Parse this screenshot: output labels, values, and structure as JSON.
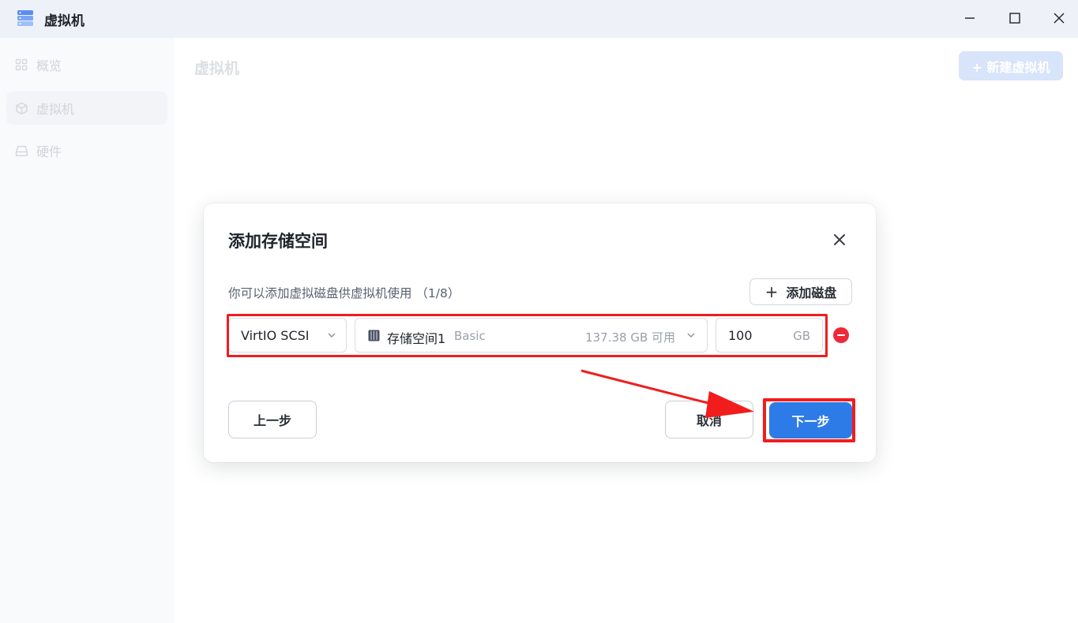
{
  "window": {
    "title": "虚拟机",
    "controls": {
      "minimize": "minimize-icon",
      "maximize": "maximize-icon",
      "close": "close-icon"
    }
  },
  "sidebar": {
    "items": [
      {
        "label": "概览",
        "icon": "grid-icon",
        "active": false
      },
      {
        "label": "虚拟机",
        "icon": "cube-icon",
        "active": true
      },
      {
        "label": "硬件",
        "icon": "drive-icon",
        "active": false
      }
    ]
  },
  "main": {
    "title": "虚拟机",
    "new_vm_label": "+ 新建虚拟机"
  },
  "dialog": {
    "title": "添加存储空间",
    "description": "你可以添加虚拟磁盘供虚拟机使用 （1/8）",
    "add_disk_label": "添加磁盘",
    "disk": {
      "bus": "VirtIO SCSI",
      "pool_name": "存储空间1",
      "pool_type": "Basic",
      "pool_free": "137.38 GB 可用",
      "size": "100",
      "unit": "GB"
    },
    "prev_label": "上一步",
    "cancel_label": "取消",
    "next_label": "下一步"
  },
  "colors": {
    "accent": "#2d7be6",
    "annotation_red": "#f21c1c",
    "remove_red": "#ee2a38"
  }
}
